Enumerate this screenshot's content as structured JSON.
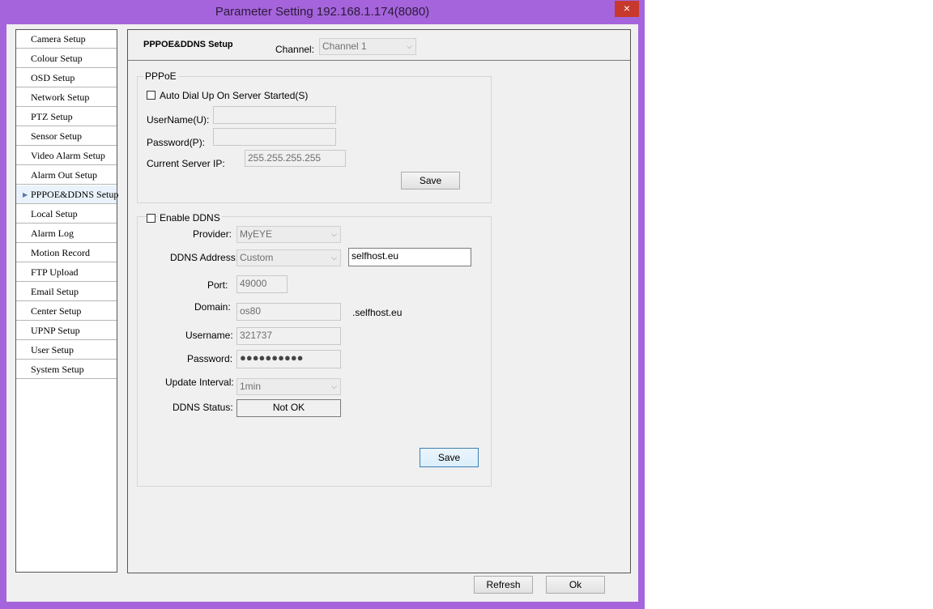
{
  "window": {
    "title": "Parameter Setting 192.168.1.174(8080)",
    "close_icon": "×"
  },
  "sidebar": {
    "items": [
      {
        "label": "Camera Setup"
      },
      {
        "label": "Colour Setup"
      },
      {
        "label": "OSD Setup"
      },
      {
        "label": "Network Setup"
      },
      {
        "label": "PTZ Setup"
      },
      {
        "label": "Sensor Setup"
      },
      {
        "label": "Video Alarm Setup"
      },
      {
        "label": "Alarm Out Setup"
      },
      {
        "label": "PPPOE&DDNS Setup"
      },
      {
        "label": "Local Setup"
      },
      {
        "label": "Alarm Log"
      },
      {
        "label": "Motion Record"
      },
      {
        "label": "FTP Upload"
      },
      {
        "label": "Email Setup"
      },
      {
        "label": "Center Setup"
      },
      {
        "label": "UPNP Setup"
      },
      {
        "label": "User Setup"
      },
      {
        "label": "System Setup"
      }
    ],
    "active_index": 8
  },
  "header": {
    "title": "PPPOE&DDNS Setup",
    "channel_label": "Channel:",
    "channel_value": "Channel 1"
  },
  "pppoe": {
    "group_title": "PPPoE",
    "auto_dial_label": "Auto Dial Up On Server Started(S)",
    "username_label": "UserName(U):",
    "username_value": "",
    "password_label": "Password(P):",
    "password_value": "",
    "server_ip_label": "Current Server IP:",
    "server_ip_value": "255.255.255.255",
    "save_label": "Save"
  },
  "ddns": {
    "enable_label": "Enable DDNS",
    "provider_label": "Provider:",
    "provider_value": "MyEYE",
    "address_label": "DDNS Address:",
    "address_select": "Custom",
    "address_value": "selfhost.eu",
    "port_label": "Port:",
    "port_value": "49000",
    "domain_label": "Domain:",
    "domain_value": "os80",
    "domain_suffix": ".selfhost.eu",
    "username_label": "Username:",
    "username_value": "321737",
    "password_label": "Password:",
    "password_mask": "●●●●●●●●●●",
    "interval_label": "Update Interval:",
    "interval_value": "1min",
    "status_label": "DDNS Status:",
    "status_value": "Not OK",
    "save_label": "Save"
  },
  "footer": {
    "refresh_label": "Refresh",
    "ok_label": "Ok"
  }
}
